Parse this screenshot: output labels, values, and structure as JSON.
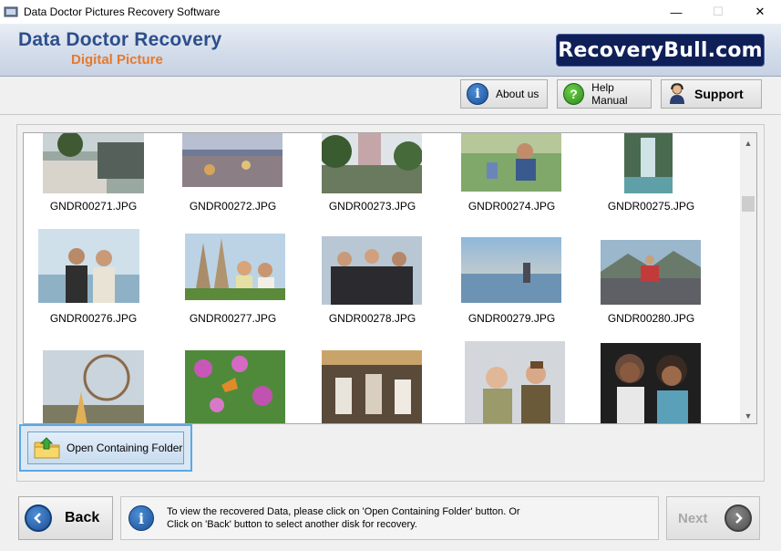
{
  "window": {
    "title": "Data Doctor Pictures Recovery Software",
    "minimize": "—",
    "maximize": "☐",
    "close": "✕"
  },
  "banner": {
    "brand_line1": "Data Doctor Recovery",
    "brand_line2": "Digital Picture",
    "logo_text": "RecoveryBull.com"
  },
  "toolbar": {
    "about_label": "About us",
    "help_label": "Help Manual",
    "support_label": "Support"
  },
  "gallery": {
    "items": [
      {
        "label": "GNDR00271.JPG"
      },
      {
        "label": "GNDR00272.JPG"
      },
      {
        "label": "GNDR00273.JPG"
      },
      {
        "label": "GNDR00274.JPG"
      },
      {
        "label": "GNDR00275.JPG"
      },
      {
        "label": "GNDR00276.JPG"
      },
      {
        "label": "GNDR00277.JPG"
      },
      {
        "label": "GNDR00278.JPG"
      },
      {
        "label": "GNDR00279.JPG"
      },
      {
        "label": "GNDR00280.JPG"
      },
      {
        "label": ""
      },
      {
        "label": ""
      },
      {
        "label": ""
      },
      {
        "label": ""
      },
      {
        "label": ""
      }
    ]
  },
  "actions": {
    "open_folder_label": "Open Containing Folder"
  },
  "footer": {
    "back_label": "Back",
    "next_label": "Next",
    "info_line1": "To view the recovered Data, please click on 'Open Containing Folder' button. Or",
    "info_line2": "Click on 'Back' button to select another disk for recovery."
  },
  "colors": {
    "brand_blue": "#2c4f8c",
    "brand_orange": "#e8792a",
    "logo_bg": "#0f1f58",
    "focus_border": "#5aa8e6"
  }
}
